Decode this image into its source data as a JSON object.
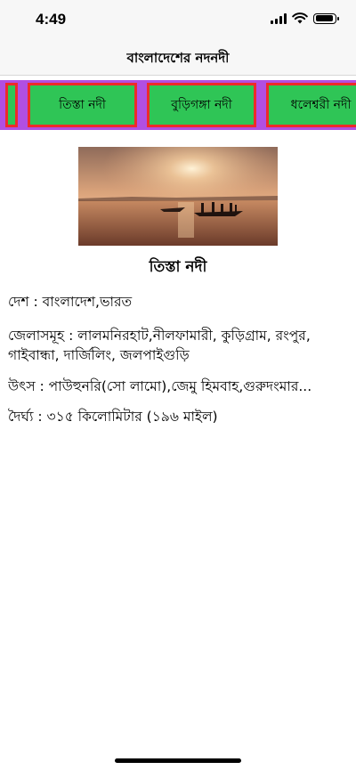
{
  "status_bar": {
    "time": "4:49",
    "icons": [
      "signal-icon",
      "wifi-icon",
      "battery-icon"
    ]
  },
  "nav": {
    "title": "বাংলাদেশের নদনদী"
  },
  "tabs": [
    {
      "label": ""
    },
    {
      "label": "তিস্তা নদী"
    },
    {
      "label": "বুড়িগঙ্গা নদী"
    },
    {
      "label": "ধলেশ্বরী নদী"
    }
  ],
  "river": {
    "name": "তিস্তা নদী",
    "country": "দেশ : বাংলাদেশ,ভারত",
    "districts": "জেলাসমূহ : লালমনিরহাট,নীলফামারী, কুড়িগ্রাম, রংপুর, গাইবান্ধা, দার্জিলিং, জলপাইগুড়ি",
    "origin": "উৎস : পাউহুনরি(সো লামো),জেমু হিমবাহ,গুরুদংমার...",
    "length": "দৈর্ঘ্য : ৩১৫ কিলোমিটার (১৯৬ মাইল)"
  },
  "colors": {
    "tab_background": "#b14fe2",
    "tab_fill": "#2fc556",
    "tab_border": "#ee2a2a"
  }
}
